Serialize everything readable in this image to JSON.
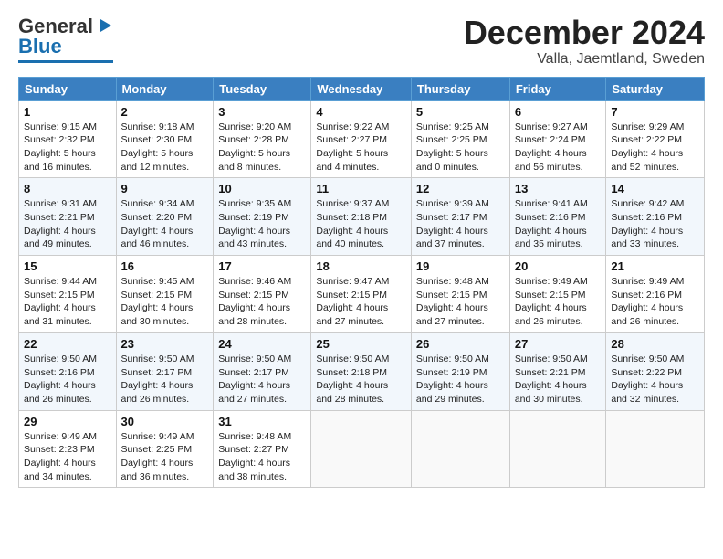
{
  "logo": {
    "text_general": "General",
    "text_blue": "Blue"
  },
  "title": "December 2024",
  "subtitle": "Valla, Jaemtland, Sweden",
  "headers": [
    "Sunday",
    "Monday",
    "Tuesday",
    "Wednesday",
    "Thursday",
    "Friday",
    "Saturday"
  ],
  "weeks": [
    [
      {
        "day": "1",
        "info": "Sunrise: 9:15 AM\nSunset: 2:32 PM\nDaylight: 5 hours\nand 16 minutes."
      },
      {
        "day": "2",
        "info": "Sunrise: 9:18 AM\nSunset: 2:30 PM\nDaylight: 5 hours\nand 12 minutes."
      },
      {
        "day": "3",
        "info": "Sunrise: 9:20 AM\nSunset: 2:28 PM\nDaylight: 5 hours\nand 8 minutes."
      },
      {
        "day": "4",
        "info": "Sunrise: 9:22 AM\nSunset: 2:27 PM\nDaylight: 5 hours\nand 4 minutes."
      },
      {
        "day": "5",
        "info": "Sunrise: 9:25 AM\nSunset: 2:25 PM\nDaylight: 5 hours\nand 0 minutes."
      },
      {
        "day": "6",
        "info": "Sunrise: 9:27 AM\nSunset: 2:24 PM\nDaylight: 4 hours\nand 56 minutes."
      },
      {
        "day": "7",
        "info": "Sunrise: 9:29 AM\nSunset: 2:22 PM\nDaylight: 4 hours\nand 52 minutes."
      }
    ],
    [
      {
        "day": "8",
        "info": "Sunrise: 9:31 AM\nSunset: 2:21 PM\nDaylight: 4 hours\nand 49 minutes."
      },
      {
        "day": "9",
        "info": "Sunrise: 9:34 AM\nSunset: 2:20 PM\nDaylight: 4 hours\nand 46 minutes."
      },
      {
        "day": "10",
        "info": "Sunrise: 9:35 AM\nSunset: 2:19 PM\nDaylight: 4 hours\nand 43 minutes."
      },
      {
        "day": "11",
        "info": "Sunrise: 9:37 AM\nSunset: 2:18 PM\nDaylight: 4 hours\nand 40 minutes."
      },
      {
        "day": "12",
        "info": "Sunrise: 9:39 AM\nSunset: 2:17 PM\nDaylight: 4 hours\nand 37 minutes."
      },
      {
        "day": "13",
        "info": "Sunrise: 9:41 AM\nSunset: 2:16 PM\nDaylight: 4 hours\nand 35 minutes."
      },
      {
        "day": "14",
        "info": "Sunrise: 9:42 AM\nSunset: 2:16 PM\nDaylight: 4 hours\nand 33 minutes."
      }
    ],
    [
      {
        "day": "15",
        "info": "Sunrise: 9:44 AM\nSunset: 2:15 PM\nDaylight: 4 hours\nand 31 minutes."
      },
      {
        "day": "16",
        "info": "Sunrise: 9:45 AM\nSunset: 2:15 PM\nDaylight: 4 hours\nand 30 minutes."
      },
      {
        "day": "17",
        "info": "Sunrise: 9:46 AM\nSunset: 2:15 PM\nDaylight: 4 hours\nand 28 minutes."
      },
      {
        "day": "18",
        "info": "Sunrise: 9:47 AM\nSunset: 2:15 PM\nDaylight: 4 hours\nand 27 minutes."
      },
      {
        "day": "19",
        "info": "Sunrise: 9:48 AM\nSunset: 2:15 PM\nDaylight: 4 hours\nand 27 minutes."
      },
      {
        "day": "20",
        "info": "Sunrise: 9:49 AM\nSunset: 2:15 PM\nDaylight: 4 hours\nand 26 minutes."
      },
      {
        "day": "21",
        "info": "Sunrise: 9:49 AM\nSunset: 2:16 PM\nDaylight: 4 hours\nand 26 minutes."
      }
    ],
    [
      {
        "day": "22",
        "info": "Sunrise: 9:50 AM\nSunset: 2:16 PM\nDaylight: 4 hours\nand 26 minutes."
      },
      {
        "day": "23",
        "info": "Sunrise: 9:50 AM\nSunset: 2:17 PM\nDaylight: 4 hours\nand 26 minutes."
      },
      {
        "day": "24",
        "info": "Sunrise: 9:50 AM\nSunset: 2:17 PM\nDaylight: 4 hours\nand 27 minutes."
      },
      {
        "day": "25",
        "info": "Sunrise: 9:50 AM\nSunset: 2:18 PM\nDaylight: 4 hours\nand 28 minutes."
      },
      {
        "day": "26",
        "info": "Sunrise: 9:50 AM\nSunset: 2:19 PM\nDaylight: 4 hours\nand 29 minutes."
      },
      {
        "day": "27",
        "info": "Sunrise: 9:50 AM\nSunset: 2:21 PM\nDaylight: 4 hours\nand 30 minutes."
      },
      {
        "day": "28",
        "info": "Sunrise: 9:50 AM\nSunset: 2:22 PM\nDaylight: 4 hours\nand 32 minutes."
      }
    ],
    [
      {
        "day": "29",
        "info": "Sunrise: 9:49 AM\nSunset: 2:23 PM\nDaylight: 4 hours\nand 34 minutes."
      },
      {
        "day": "30",
        "info": "Sunrise: 9:49 AM\nSunset: 2:25 PM\nDaylight: 4 hours\nand 36 minutes."
      },
      {
        "day": "31",
        "info": "Sunrise: 9:48 AM\nSunset: 2:27 PM\nDaylight: 4 hours\nand 38 minutes."
      },
      null,
      null,
      null,
      null
    ]
  ]
}
